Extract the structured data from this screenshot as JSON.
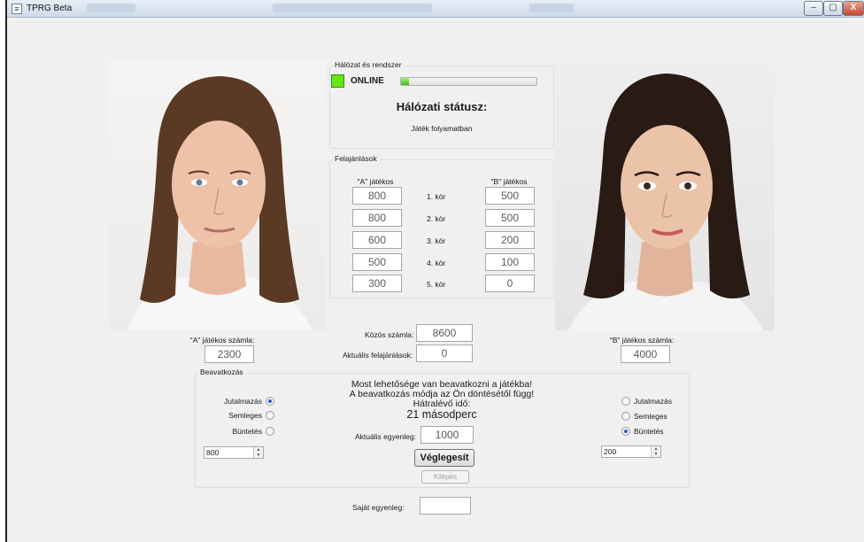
{
  "window": {
    "title": "TPRG Beta",
    "minimize": "–",
    "maximize": "▢",
    "close": "X"
  },
  "network": {
    "group_label": "Hálózat és rendszer",
    "online_label": "ONLINE",
    "progress": 0.06,
    "status_title": "Hálózati státusz:",
    "status_text": "Játék folyamatban"
  },
  "offers": {
    "group_label": "Felajánlások",
    "col_a": "\"A\" játékos",
    "col_b": "\"B\" játékos",
    "rounds": [
      {
        "label": "1. kör",
        "a": "800",
        "b": "500"
      },
      {
        "label": "2. kör",
        "a": "800",
        "b": "500"
      },
      {
        "label": "3. kör",
        "a": "600",
        "b": "200"
      },
      {
        "label": "4. kör",
        "a": "500",
        "b": "100"
      },
      {
        "label": "5. kör",
        "a": "300",
        "b": "0"
      }
    ]
  },
  "player_a": {
    "account_label": "\"A\" játékos számla:",
    "account_value": "2300"
  },
  "player_b": {
    "account_label": "\"B\" játékos számla:",
    "account_value": "4000"
  },
  "common": {
    "account_label": "Közös számla:",
    "account_value": "8600",
    "current_offers_label": "Aktuális felajánlások:",
    "current_offers_value": "0"
  },
  "intervention": {
    "group_label": "Beavatkozás",
    "message_1": "Most lehetősége van beavatkozni a játékba!",
    "message_2": "A beavatkozás módja az Ön döntésétől függ!",
    "time_label": "Hátralévő idő:",
    "time_value": "21 másodperc",
    "balance_label": "Aktuális egyenleg:",
    "balance_value": "1000",
    "finalize_button": "Véglegesít",
    "exit_button": "Kilépés",
    "left_options": [
      "Jutalmazás",
      "Semleges",
      "Büntetés"
    ],
    "left_selected": 0,
    "left_amount": "800",
    "right_options": [
      "Jutalmazás",
      "Semleges",
      "Büntetés"
    ],
    "right_selected": 2,
    "right_amount": "200"
  },
  "own": {
    "balance_label": "Saját egyenleg:",
    "balance_value": ""
  },
  "colors": {
    "online_led": "#66e617",
    "window_bg": "#f0f0f0",
    "radio_selected": "#2a5dbe"
  }
}
